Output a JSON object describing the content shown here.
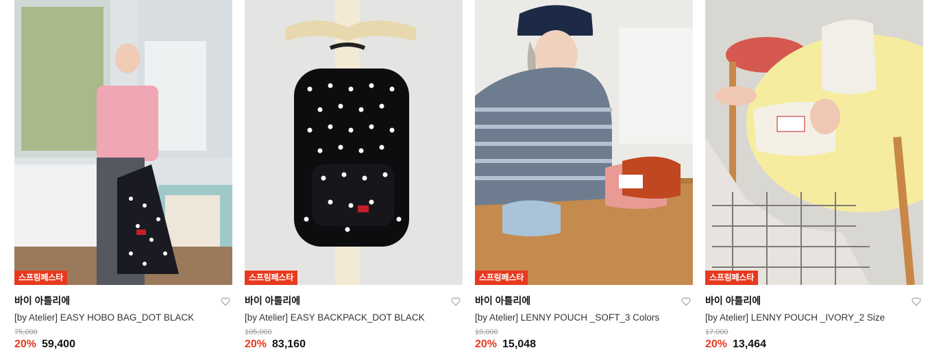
{
  "products": [
    {
      "badge": "스프링페스타",
      "brand": "바이 아틀리에",
      "name": "[by Atelier] EASY HOBO BAG_DOT BLACK",
      "original_price": "75,000",
      "discount": "20%",
      "price": "59,400",
      "image_alt": "product-photo-hobo-bag"
    },
    {
      "badge": "스프링페스타",
      "brand": "바이 아틀리에",
      "name": "[by Atelier] EASY BACKPACK_DOT BLACK",
      "original_price": "105,000",
      "discount": "20%",
      "price": "83,160",
      "image_alt": "product-photo-backpack"
    },
    {
      "badge": "스프링페스타",
      "brand": "바이 아틀리에",
      "name": "[by Atelier] LENNY POUCH _SOFT_3 Colors",
      "original_price": "19,000",
      "discount": "20%",
      "price": "15,048",
      "image_alt": "product-photo-soft-pouch"
    },
    {
      "badge": "스프링페스타",
      "brand": "바이 아틀리에",
      "name": "[by Atelier] LENNY POUCH _IVORY_2 Size",
      "original_price": "17,000",
      "discount": "20%",
      "price": "13,464",
      "image_alt": "product-photo-ivory-pouch"
    }
  ],
  "colors": {
    "accent": "#e8391e",
    "text": "#111111",
    "muted": "#9a9a9a"
  },
  "icons": {
    "wishlist": "heart-outline-icon"
  }
}
